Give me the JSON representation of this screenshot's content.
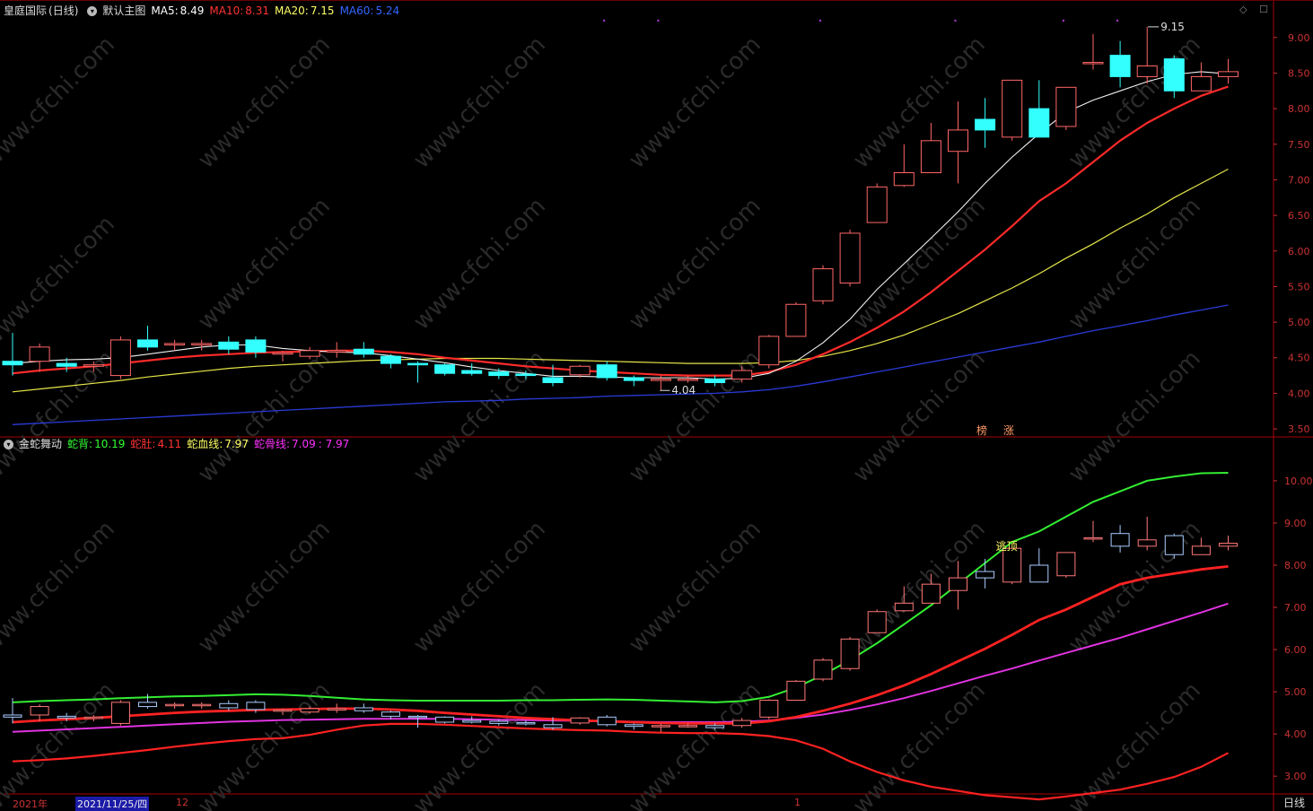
{
  "main": {
    "stock_name": "皇庭国际",
    "period_label": "(日线)",
    "template_label": "默认主图",
    "ma": [
      {
        "label": "MA5:",
        "value": "8.49",
        "color": "#ffffff"
      },
      {
        "label": "MA10:",
        "value": "8.31",
        "color": "#ff3333"
      },
      {
        "label": "MA20:",
        "value": "7.15",
        "color": "#ffff66"
      },
      {
        "label": "MA60:",
        "value": "5.24",
        "color": "#3366ff"
      }
    ],
    "y_ticks": [
      "9.00",
      "8.50",
      "8.00",
      "7.50",
      "7.00",
      "6.50",
      "6.00",
      "5.50",
      "5.00",
      "4.50",
      "4.00",
      "3.50"
    ],
    "high_label": "9.15",
    "low_label": "4.04",
    "tags": [
      "榜",
      "涨"
    ]
  },
  "sub": {
    "indicator_name": "金蛇舞动",
    "lines": [
      {
        "label": "蛇背:",
        "value": "10.19",
        "color": "#33ff33"
      },
      {
        "label": "蛇肚:",
        "value": "4.11",
        "color": "#ff3333"
      },
      {
        "label": "蛇血线:",
        "value": "7.97",
        "color": "#ffff66"
      },
      {
        "label": "蛇骨线:",
        "value": "7.09",
        "color": "#ff33ff"
      }
    ],
    "extra_value": ": 7.97",
    "y_ticks": [
      "10.00",
      "9.00",
      "8.00",
      "7.00",
      "6.00",
      "5.00",
      "4.00",
      "3.00"
    ],
    "signal_label": "逃顶"
  },
  "xaxis": {
    "year": "2021年",
    "date": "2021/11/25/四",
    "month_12": "12",
    "month_1": "1"
  },
  "period_button": "日线",
  "chart_data": {
    "type": "candlestick",
    "ylim_main": [
      3.4,
      9.3
    ],
    "ylim_sub": [
      2.6,
      10.7
    ],
    "candles": [
      [
        4.45,
        4.4,
        4.85,
        4.25
      ],
      [
        4.45,
        4.65,
        4.7,
        4.3
      ],
      [
        4.42,
        4.38,
        4.5,
        4.3
      ],
      [
        4.38,
        4.4,
        4.45,
        4.3
      ],
      [
        4.25,
        4.75,
        4.8,
        4.2
      ],
      [
        4.75,
        4.65,
        4.95,
        4.6
      ],
      [
        4.68,
        4.7,
        4.75,
        4.6
      ],
      [
        4.68,
        4.7,
        4.75,
        4.6
      ],
      [
        4.72,
        4.62,
        4.8,
        4.55
      ],
      [
        4.75,
        4.58,
        4.8,
        4.5
      ],
      [
        4.55,
        4.57,
        4.6,
        4.45
      ],
      [
        4.52,
        4.6,
        4.65,
        4.48
      ],
      [
        4.58,
        4.6,
        4.72,
        4.5
      ],
      [
        4.62,
        4.55,
        4.72,
        4.5
      ],
      [
        4.52,
        4.42,
        4.55,
        4.35
      ],
      [
        4.42,
        4.4,
        4.45,
        4.15
      ],
      [
        4.4,
        4.28,
        4.42,
        4.25
      ],
      [
        4.32,
        4.28,
        4.42,
        4.25
      ],
      [
        4.3,
        4.25,
        4.35,
        4.2
      ],
      [
        4.27,
        4.25,
        4.32,
        4.2
      ],
      [
        4.22,
        4.15,
        4.4,
        4.1
      ],
      [
        4.26,
        4.38,
        4.4,
        4.22
      ],
      [
        4.4,
        4.22,
        4.45,
        4.18
      ],
      [
        4.22,
        4.18,
        4.25,
        4.1
      ],
      [
        4.18,
        4.2,
        4.25,
        4.04
      ],
      [
        4.2,
        4.2,
        4.25,
        4.15
      ],
      [
        4.2,
        4.15,
        4.25,
        4.1
      ],
      [
        4.2,
        4.32,
        4.38,
        4.15
      ],
      [
        4.4,
        4.8,
        4.82,
        4.35
      ],
      [
        4.8,
        5.25,
        5.28,
        4.8
      ],
      [
        5.3,
        5.75,
        5.8,
        5.25
      ],
      [
        5.55,
        6.25,
        6.3,
        5.5
      ],
      [
        6.4,
        6.9,
        6.95,
        6.4
      ],
      [
        6.92,
        7.1,
        7.5,
        6.9
      ],
      [
        7.1,
        7.55,
        7.8,
        7.1
      ],
      [
        7.4,
        7.7,
        8.1,
        6.95
      ],
      [
        7.85,
        7.7,
        8.15,
        7.45
      ],
      [
        7.6,
        8.4,
        8.4,
        7.55
      ],
      [
        8.0,
        7.6,
        8.4,
        7.6
      ],
      [
        7.75,
        8.3,
        8.3,
        7.7
      ],
      [
        8.65,
        8.65,
        9.05,
        8.55
      ],
      [
        8.75,
        8.45,
        8.95,
        8.3
      ],
      [
        8.45,
        8.6,
        9.15,
        8.35
      ],
      [
        8.7,
        8.25,
        8.75,
        8.15
      ],
      [
        8.25,
        8.45,
        8.65,
        8.25
      ],
      [
        8.45,
        8.52,
        8.7,
        8.35
      ]
    ],
    "ma5": [
      4.42,
      4.45,
      4.47,
      4.48,
      4.5,
      4.55,
      4.6,
      4.65,
      4.68,
      4.68,
      4.63,
      4.6,
      4.58,
      4.57,
      4.53,
      4.48,
      4.43,
      4.37,
      4.32,
      4.28,
      4.24,
      4.24,
      4.23,
      4.22,
      4.22,
      4.22,
      4.2,
      4.21,
      4.28,
      4.45,
      4.71,
      5.04,
      5.46,
      5.82,
      6.18,
      6.55,
      6.95,
      7.32,
      7.65,
      7.95,
      8.12,
      8.25,
      8.38,
      8.48,
      8.52,
      8.49
    ],
    "ma10": [
      4.28,
      4.32,
      4.35,
      4.38,
      4.42,
      4.46,
      4.5,
      4.53,
      4.55,
      4.57,
      4.58,
      4.59,
      4.6,
      4.6,
      4.58,
      4.55,
      4.5,
      4.46,
      4.42,
      4.38,
      4.35,
      4.32,
      4.3,
      4.28,
      4.26,
      4.25,
      4.25,
      4.25,
      4.3,
      4.4,
      4.55,
      4.72,
      4.92,
      5.15,
      5.42,
      5.72,
      6.02,
      6.35,
      6.7,
      6.95,
      7.25,
      7.55,
      7.8,
      8.0,
      8.18,
      8.31
    ],
    "ma20": [
      4.02,
      4.06,
      4.1,
      4.14,
      4.18,
      4.23,
      4.27,
      4.31,
      4.35,
      4.38,
      4.4,
      4.42,
      4.44,
      4.46,
      4.47,
      4.48,
      4.49,
      4.49,
      4.49,
      4.48,
      4.47,
      4.46,
      4.45,
      4.44,
      4.43,
      4.42,
      4.42,
      4.42,
      4.43,
      4.46,
      4.52,
      4.6,
      4.7,
      4.82,
      4.97,
      5.12,
      5.3,
      5.48,
      5.68,
      5.9,
      6.1,
      6.32,
      6.52,
      6.75,
      6.95,
      7.15
    ],
    "ma60": [
      3.56,
      3.58,
      3.6,
      3.62,
      3.64,
      3.66,
      3.68,
      3.7,
      3.72,
      3.74,
      3.76,
      3.78,
      3.8,
      3.82,
      3.84,
      3.86,
      3.88,
      3.89,
      3.9,
      3.92,
      3.93,
      3.94,
      3.96,
      3.97,
      3.98,
      3.99,
      4.0,
      4.02,
      4.05,
      4.1,
      4.16,
      4.23,
      4.3,
      4.37,
      4.44,
      4.51,
      4.58,
      4.65,
      4.72,
      4.8,
      4.88,
      4.95,
      5.02,
      5.1,
      5.17,
      5.24
    ],
    "snake_back": [
      4.75,
      4.78,
      4.8,
      4.82,
      4.85,
      4.87,
      4.89,
      4.9,
      4.92,
      4.94,
      4.93,
      4.9,
      4.86,
      4.82,
      4.8,
      4.79,
      4.79,
      4.79,
      4.79,
      4.8,
      4.8,
      4.81,
      4.82,
      4.81,
      4.79,
      4.77,
      4.75,
      4.78,
      4.88,
      5.1,
      5.4,
      5.75,
      6.15,
      6.6,
      7.05,
      7.55,
      8.05,
      8.55,
      8.8,
      9.15,
      9.5,
      9.75,
      10.0,
      10.1,
      10.18,
      10.19
    ],
    "snake_belly": [
      3.35,
      3.38,
      3.42,
      3.48,
      3.55,
      3.62,
      3.7,
      3.77,
      3.83,
      3.88,
      3.9,
      3.98,
      4.1,
      4.2,
      4.24,
      4.24,
      4.22,
      4.19,
      4.16,
      4.13,
      4.11,
      4.09,
      4.08,
      4.05,
      4.03,
      4.02,
      4.02,
      4.0,
      3.95,
      3.85,
      3.65,
      3.35,
      3.1,
      2.9,
      2.75,
      2.65,
      2.55,
      2.5,
      2.45,
      2.52,
      2.6,
      2.68,
      2.82,
      2.98,
      3.22,
      3.55
    ],
    "snake_blood": [
      4.28,
      4.32,
      4.35,
      4.38,
      4.42,
      4.46,
      4.5,
      4.53,
      4.55,
      4.57,
      4.58,
      4.59,
      4.6,
      4.6,
      4.58,
      4.55,
      4.5,
      4.46,
      4.42,
      4.38,
      4.35,
      4.32,
      4.3,
      4.28,
      4.26,
      4.25,
      4.25,
      4.25,
      4.3,
      4.4,
      4.55,
      4.72,
      4.92,
      5.15,
      5.42,
      5.72,
      6.02,
      6.35,
      6.7,
      6.95,
      7.25,
      7.55,
      7.7,
      7.8,
      7.9,
      7.97
    ],
    "snake_bone": [
      4.05,
      4.08,
      4.11,
      4.14,
      4.17,
      4.2,
      4.23,
      4.26,
      4.29,
      4.31,
      4.33,
      4.34,
      4.35,
      4.36,
      4.36,
      4.36,
      4.36,
      4.35,
      4.34,
      4.33,
      4.32,
      4.31,
      4.3,
      4.29,
      4.28,
      4.28,
      4.28,
      4.29,
      4.32,
      4.38,
      4.46,
      4.57,
      4.7,
      4.85,
      5.02,
      5.2,
      5.38,
      5.55,
      5.74,
      5.92,
      6.1,
      6.28,
      6.48,
      6.68,
      6.88,
      7.09
    ]
  }
}
